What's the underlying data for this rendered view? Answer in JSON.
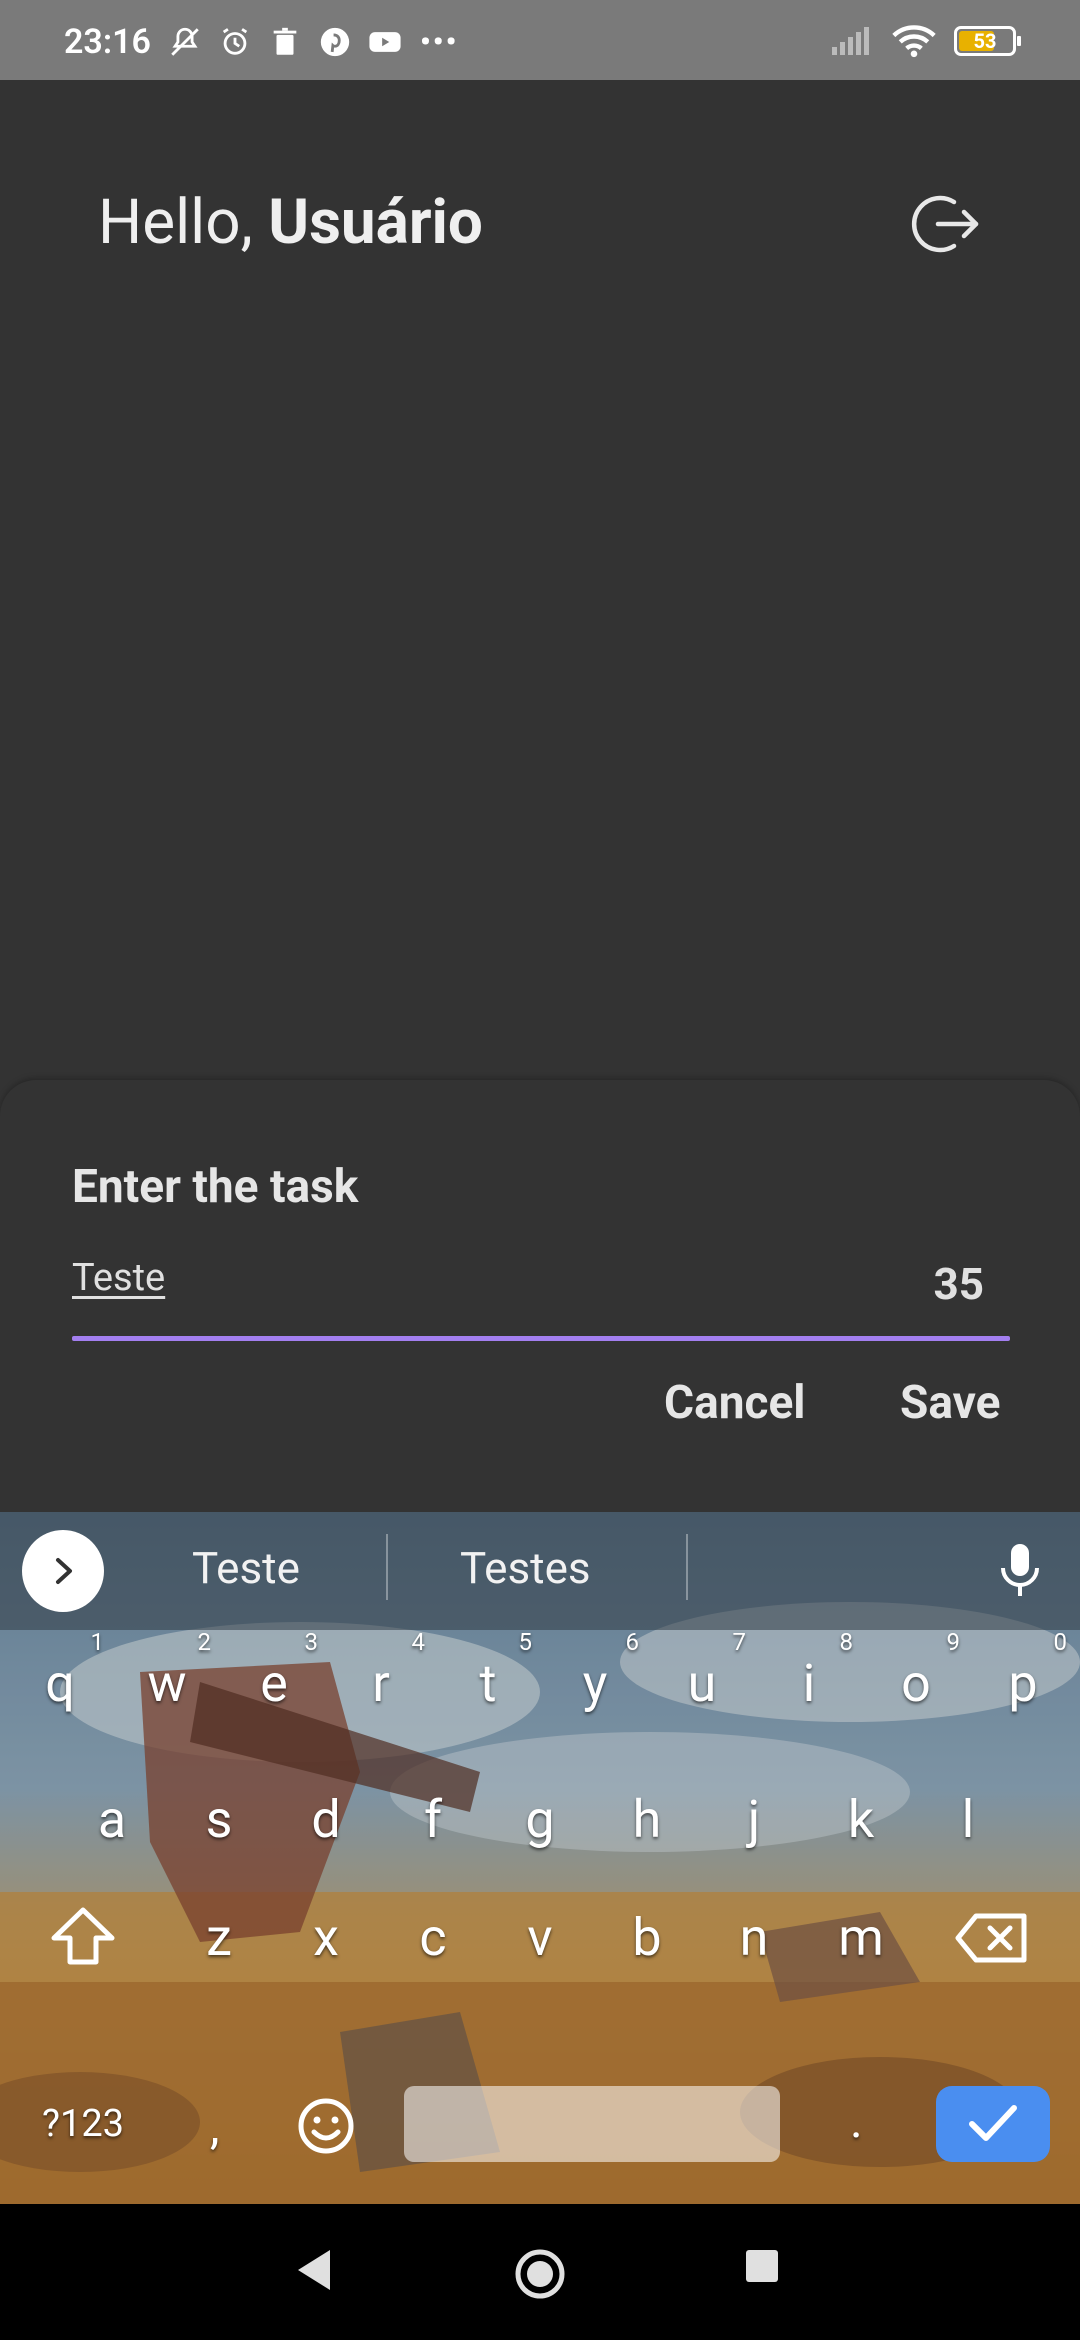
{
  "status_bar": {
    "time": "23:16",
    "battery": "53",
    "more": "•••",
    "icons": [
      "bell-off-icon",
      "alarm-icon",
      "trash-icon",
      "pinterest-icon",
      "youtube-icon",
      "signal-icon",
      "wifi-icon",
      "battery-icon"
    ]
  },
  "header": {
    "greeting_prefix": "Hello, ",
    "user_name": "Usuário"
  },
  "dialog": {
    "title": "Enter the task",
    "input_value": "Teste",
    "char_counter": "35",
    "cancel_label": "Cancel",
    "save_label": "Save",
    "accent_color": "#a37ff0"
  },
  "keyboard": {
    "suggestions": [
      "Teste",
      "Testes"
    ],
    "row1": [
      {
        "l": "q",
        "n": "1"
      },
      {
        "l": "w",
        "n": "2"
      },
      {
        "l": "e",
        "n": "3"
      },
      {
        "l": "r",
        "n": "4"
      },
      {
        "l": "t",
        "n": "5"
      },
      {
        "l": "y",
        "n": "6"
      },
      {
        "l": "u",
        "n": "7"
      },
      {
        "l": "i",
        "n": "8"
      },
      {
        "l": "o",
        "n": "9"
      },
      {
        "l": "p",
        "n": "0"
      }
    ],
    "row2": [
      "a",
      "s",
      "d",
      "f",
      "g",
      "h",
      "j",
      "k",
      "l"
    ],
    "row3": [
      "z",
      "x",
      "c",
      "v",
      "b",
      "n",
      "m"
    ],
    "symbols_label": "?123",
    "comma": ",",
    "period": ".",
    "enter_color": "#4a8ef0"
  }
}
